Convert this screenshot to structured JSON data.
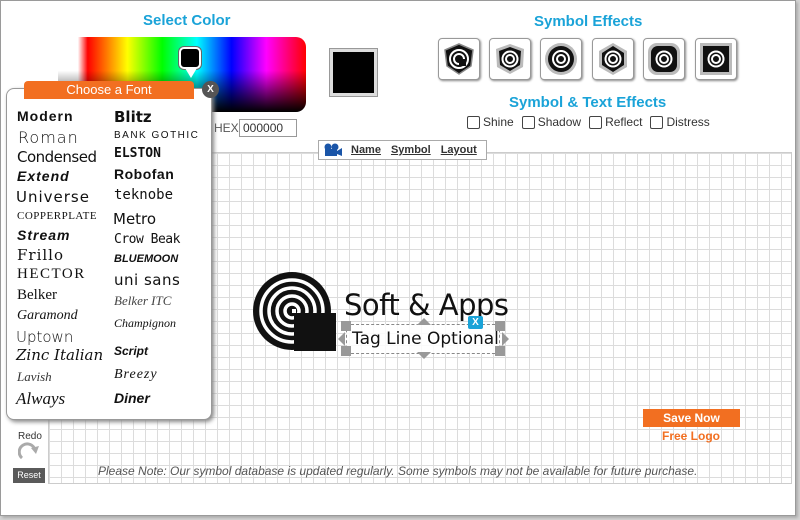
{
  "headings": {
    "select_color": "Select Color",
    "symbol_effects": "Symbol Effects",
    "symbol_text_effects": "Symbol & Text Effects"
  },
  "color": {
    "hex_label": "HEX",
    "hex_value": "000000",
    "current": "#000000"
  },
  "effect_checkboxes": [
    {
      "label": "Shine",
      "checked": false
    },
    {
      "label": "Shadow",
      "checked": false
    },
    {
      "label": "Reflect",
      "checked": false
    },
    {
      "label": "Distress",
      "checked": false
    }
  ],
  "symbol_effect_icons": [
    "shield-badge-icon",
    "shield-badge-icon",
    "circle-badge-icon",
    "hexagon-badge-icon",
    "rounded-square-badge-icon",
    "square-badge-icon"
  ],
  "editor_tabs": [
    {
      "label": "Name"
    },
    {
      "label": "Symbol"
    },
    {
      "label": "Layout"
    }
  ],
  "logo": {
    "company_name": "Soft & Apps",
    "tagline": "Tag Line Optional",
    "close_label": "X"
  },
  "font_panel": {
    "title": "Choose a Font",
    "close_label": "X",
    "left_fonts": [
      "Modern",
      "Roman",
      "Condensed",
      "Extend",
      "Universe",
      "COPPERPLATE",
      "Stream",
      "Frillo",
      "HECTOR",
      "Belker",
      "Garamond",
      "Uptown",
      "Zinc Italian",
      "Lavish",
      "Always"
    ],
    "right_fonts": [
      "Blitz",
      "BANK GOTHIC",
      "ELSTON",
      "Robofan",
      "teknobe",
      "Metro",
      "Crow Beak",
      "BLUEMOON",
      "uni sans",
      "Belker ITC",
      "Champignon",
      "Script",
      "Breezy",
      "Diner"
    ]
  },
  "tools": {
    "redo_label": "Redo",
    "reset_label": "Reset"
  },
  "actions": {
    "save_label": "Save Now",
    "free_logo_label": "Free Logo"
  },
  "note": "Please Note: Our symbol database is updated regularly. Some symbols may not be available for future purchase.",
  "colors": {
    "accent_blue": "#1aa3d8",
    "accent_orange": "#f26f21"
  }
}
